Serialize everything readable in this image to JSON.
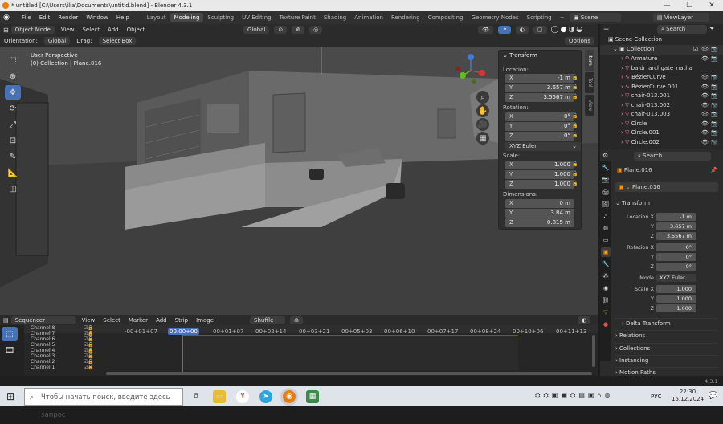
{
  "window": {
    "title": "* untitled [C:\\Users\\ilia\\Documents\\untitld.blend] - Blender 4.3.1",
    "min": "—",
    "max": "☐",
    "close": "✕"
  },
  "menu": {
    "items": [
      "File",
      "Edit",
      "Render",
      "Window",
      "Help"
    ],
    "workspaces": [
      "Layout",
      "Modeling",
      "Sculpting",
      "UV Editing",
      "Texture Paint",
      "Shading",
      "Animation",
      "Rendering",
      "Compositing",
      "Geometry Nodes",
      "Scripting",
      "+"
    ],
    "scene": "Scene",
    "viewlayer": "ViewLayer"
  },
  "header3d": {
    "mode": "Object Mode",
    "menus": [
      "View",
      "Select",
      "Add",
      "Object"
    ],
    "transform_space": "Global",
    "orientation_label": "Orientation:",
    "orientation": "Global",
    "drag_label": "Drag:",
    "drag": "Select Box",
    "options": "Options"
  },
  "viewport": {
    "perspective": "User Perspective",
    "collection": "(0) Collection | Plane.016"
  },
  "npanel": {
    "title": "Transform",
    "location_label": "Location:",
    "loc": [
      {
        "ax": "X",
        "val": "-1 m"
      },
      {
        "ax": "Y",
        "val": "3.657 m"
      },
      {
        "ax": "Z",
        "val": "3.5567 m"
      }
    ],
    "rotation_label": "Rotation:",
    "rot": [
      {
        "ax": "X",
        "val": "0°"
      },
      {
        "ax": "Y",
        "val": "0°"
      },
      {
        "ax": "Z",
        "val": "0°"
      }
    ],
    "rot_mode": "XYZ Euler",
    "scale_label": "Scale:",
    "scale": [
      {
        "ax": "X",
        "val": "1.000"
      },
      {
        "ax": "Y",
        "val": "1.000"
      },
      {
        "ax": "Z",
        "val": "1.000"
      }
    ],
    "dims_label": "Dimensions:",
    "dims": [
      {
        "ax": "X",
        "val": "0 m"
      },
      {
        "ax": "Y",
        "val": "3.84 m"
      },
      {
        "ax": "Z",
        "val": "0.815 m"
      }
    ],
    "tabs": [
      "Item",
      "Tool",
      "View"
    ]
  },
  "outliner": {
    "search": "Search",
    "root": "Scene Collection",
    "collection": "Collection",
    "items": [
      "Armature",
      "baldr_archgate_natha",
      "BézierCurve",
      "BézierCurve.001",
      "chair-013.001",
      "chair-013.002",
      "chair-013.003",
      "Circle",
      "Circle.001",
      "Circle.002"
    ]
  },
  "properties": {
    "search": "Search",
    "object": "Plane.016",
    "object2": "Plane.016",
    "transform": "Transform",
    "location_label": "Location X",
    "loc": [
      "-1 m",
      "3.657 m",
      "3.5567 m"
    ],
    "rotation_label": "Rotation X",
    "rot": [
      "0°",
      "0°",
      "0°"
    ],
    "mode_label": "Mode",
    "mode": "XYZ Euler",
    "scale_label": "Scale X",
    "scale": [
      "1.000",
      "1.000",
      "1.000"
    ],
    "axis_y": "Y",
    "axis_z": "Z",
    "sections": [
      "Delta Transform",
      "Relations",
      "Collections",
      "Instancing",
      "Motion Paths"
    ]
  },
  "sequencer": {
    "name": "Sequencer",
    "menus": [
      "View",
      "Select",
      "Marker",
      "Add",
      "Strip",
      "Image"
    ],
    "mode": "Shuffle",
    "channels": [
      "Channel 8",
      "Channel 7",
      "Channel 6",
      "Channel 5",
      "Channel 4",
      "Channel 3",
      "Channel 2",
      "Channel 1"
    ],
    "times": [
      "-00+01+07",
      "00:00+00",
      "00+01+07",
      "00+02+14",
      "00+03+21",
      "00+05+03",
      "00+06+10",
      "00+07+17",
      "00+08+24",
      "00+10+06",
      "00+11+13"
    ]
  },
  "statusbar": {
    "version": "4.3.1"
  },
  "taskbar": {
    "search": "Чтобы начать поиск, введите здесь запрос",
    "lang": "РУС",
    "time": "22:30",
    "date": "15.12.2024"
  }
}
